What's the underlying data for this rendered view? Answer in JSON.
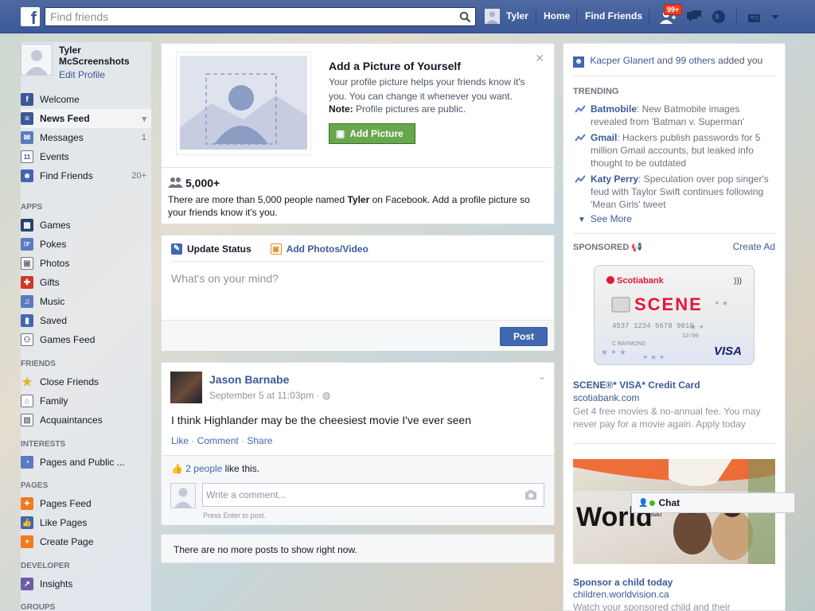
{
  "topbar": {
    "search_placeholder": "Find friends",
    "user_name": "Tyler",
    "home": "Home",
    "find_friends": "Find Friends",
    "friend_requests_badge": "99+"
  },
  "sidebar": {
    "profile_name": "Tyler McScreenshots",
    "edit_profile": "Edit Profile",
    "main_items": [
      {
        "label": "Welcome",
        "icon": "facebook-icon",
        "count": ""
      },
      {
        "label": "News Feed",
        "icon": "news-feed-icon",
        "count": ""
      },
      {
        "label": "Messages",
        "icon": "messages-icon",
        "count": "1"
      },
      {
        "label": "Events",
        "icon": "calendar-icon",
        "count": ""
      },
      {
        "label": "Find Friends",
        "icon": "find-friends-icon",
        "count": "20+"
      }
    ],
    "apps_head": "APPS",
    "apps_items": [
      {
        "label": "Games",
        "icon": "games-icon"
      },
      {
        "label": "Pokes",
        "icon": "pokes-icon"
      },
      {
        "label": "Photos",
        "icon": "photos-icon"
      },
      {
        "label": "Gifts",
        "icon": "gift-icon"
      },
      {
        "label": "Music",
        "icon": "music-icon"
      },
      {
        "label": "Saved",
        "icon": "saved-icon"
      },
      {
        "label": "Games Feed",
        "icon": "games-feed-icon"
      }
    ],
    "friends_head": "FRIENDS",
    "friends_items": [
      {
        "label": "Close Friends",
        "icon": "star-icon"
      },
      {
        "label": "Family",
        "icon": "family-icon"
      },
      {
        "label": "Acquaintances",
        "icon": "acquaintances-icon"
      }
    ],
    "interests_head": "INTERESTS",
    "interests_items": [
      {
        "label": "Pages and Public ...",
        "icon": "rss-icon"
      }
    ],
    "pages_head": "PAGES",
    "pages_items": [
      {
        "label": "Pages Feed",
        "icon": "pages-feed-icon"
      },
      {
        "label": "Like Pages",
        "icon": "like-icon"
      },
      {
        "label": "Create Page",
        "icon": "create-page-icon"
      }
    ],
    "developer_head": "DEVELOPER",
    "developer_items": [
      {
        "label": "Insights",
        "icon": "insights-icon"
      }
    ],
    "groups_head": "GROUPS"
  },
  "picture_card": {
    "title": "Add a Picture of Yourself",
    "desc": "Your profile picture helps your friends know it's you. You can change it whenever you want.",
    "note_bold": "Note:",
    "note_text": " Profile pictures are public.",
    "button": "Add Picture",
    "count": "5,000+",
    "count_text_1": "There are more than 5,000 people named ",
    "count_name": "Tyler",
    "count_text_2": " on Facebook. Add a profile picture so your friends know it's you."
  },
  "composer": {
    "tab_status": "Update Status",
    "tab_photos": "Add Photos/Video",
    "placeholder": "What's on your mind?",
    "post": "Post"
  },
  "post": {
    "author": "Jason Barnabe",
    "time": "September 5 at 11:03pm · ",
    "text": "I think Highlander may be the cheesiest movie I've ever seen",
    "like": "Like",
    "comment": "Comment",
    "share": "Share",
    "likes_people": "2 people",
    "likes_suffix": " like this.",
    "comment_placeholder": "Write a comment...",
    "press_enter": "Press Enter to post."
  },
  "feed_end": "There are no more posts to show right now.",
  "right": {
    "notif_name": "Kacper Glanert",
    "notif_and": " and ",
    "notif_others": "99 others",
    "notif_suffix": " added you",
    "trending_head": "TRENDING",
    "trending": [
      {
        "topic": "Batmobile",
        "text": ": New Batmobile images revealed from 'Batman v. Superman'"
      },
      {
        "topic": "Gmail",
        "text": ": Hackers publish passwords for 5 million Gmail accounts, but leaked info thought to be outdated"
      },
      {
        "topic": "Katy Perry",
        "text": ": Speculation over pop singer's feud with Taylor Swift continues following 'Mean Girls' tweet"
      }
    ],
    "see_more": "See More",
    "sponsored_head": "SPONSORED",
    "create_ad": "Create Ad",
    "ad1_brand": "Scotiabank",
    "ad1_logo": "SCENE",
    "ad1_card_number": "4537 1234 5678 9010",
    "ad1_card_exp": "12/00",
    "ad1_cardholder": "C RAYMOND",
    "ad1_visa": "VISA",
    "ad1_title": "SCENE®* VISA* Credit Card",
    "ad1_url": "scotiabank.com",
    "ad1_desc": "Get 4 free movies & no-annual fee. You may never pay for a movie again. Apply today",
    "ad2_img_text": "World",
    "ad2_img_text2": "Visio",
    "ad2_title": "Sponsor a child today",
    "ad2_url": "children.worldvision.ca",
    "ad2_desc": "Watch your sponsored child and their"
  },
  "chat": {
    "label": "Chat"
  },
  "colors": {
    "brand": "#3b5998",
    "green_button": "#69a74e",
    "badge": "#f03d25"
  }
}
